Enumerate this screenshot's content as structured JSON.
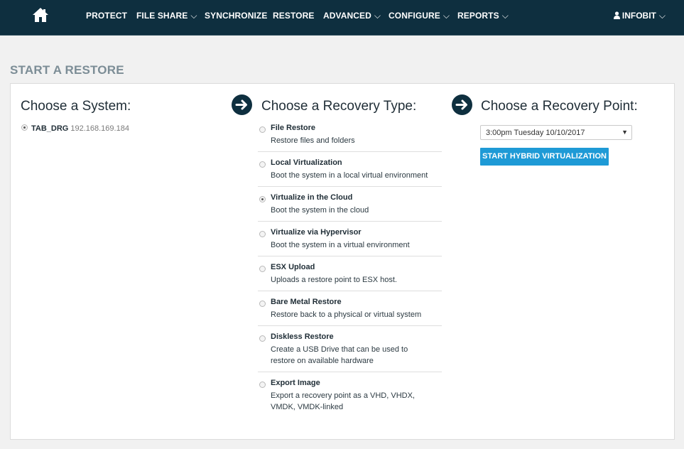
{
  "nav": {
    "home_icon": "home-icon",
    "items": [
      {
        "label": "PROTECT",
        "dropdown": false
      },
      {
        "label": "FILE SHARE",
        "dropdown": true
      },
      {
        "label": "SYNCHRONIZE",
        "dropdown": false
      },
      {
        "label": "RESTORE",
        "dropdown": false
      },
      {
        "label": "ADVANCED",
        "dropdown": true
      },
      {
        "label": "CONFIGURE",
        "dropdown": true
      },
      {
        "label": "REPORTS",
        "dropdown": true
      }
    ],
    "chevron": "⌵",
    "user": {
      "label": "INFOBIT",
      "icon": "user-icon"
    }
  },
  "page": {
    "title": "START A RESTORE"
  },
  "systems": {
    "heading": "Choose a System:",
    "items": [
      {
        "name": "TAB_DRG",
        "ip": "192.168.169.184",
        "selected": true
      }
    ]
  },
  "recovery_types": {
    "heading": "Choose a Recovery Type:",
    "items": [
      {
        "title": "File Restore",
        "description": "Restore files and folders",
        "selected": false
      },
      {
        "title": "Local Virtualization",
        "description": "Boot the system in a local virtual environment",
        "selected": false
      },
      {
        "title": "Virtualize in the Cloud",
        "description": "Boot the system in the cloud",
        "selected": true
      },
      {
        "title": "Virtualize via Hypervisor",
        "description": "Boot the system in a virtual environment",
        "selected": false
      },
      {
        "title": "ESX Upload",
        "description": "Uploads a restore point to ESX host.",
        "selected": false
      },
      {
        "title": "Bare Metal Restore",
        "description": "Restore back to a physical or virtual system",
        "selected": false
      },
      {
        "title": "Diskless Restore",
        "description": "Create a USB Drive that can be used to restore on available hardware",
        "selected": false
      },
      {
        "title": "Export Image",
        "description": "Export a recovery point as a VHD, VHDX, VMDK, VMDK-linked",
        "selected": false
      }
    ]
  },
  "recovery_point": {
    "heading": "Choose a Recovery Point:",
    "selected_value": "3:00pm Tuesday 10/10/2017",
    "button_label": "START HYBRID VIRTUALIZATION"
  },
  "colors": {
    "nav_bg": "#0e2f3f",
    "accent": "#1e9ad6",
    "title_gray": "#7c8d96"
  }
}
